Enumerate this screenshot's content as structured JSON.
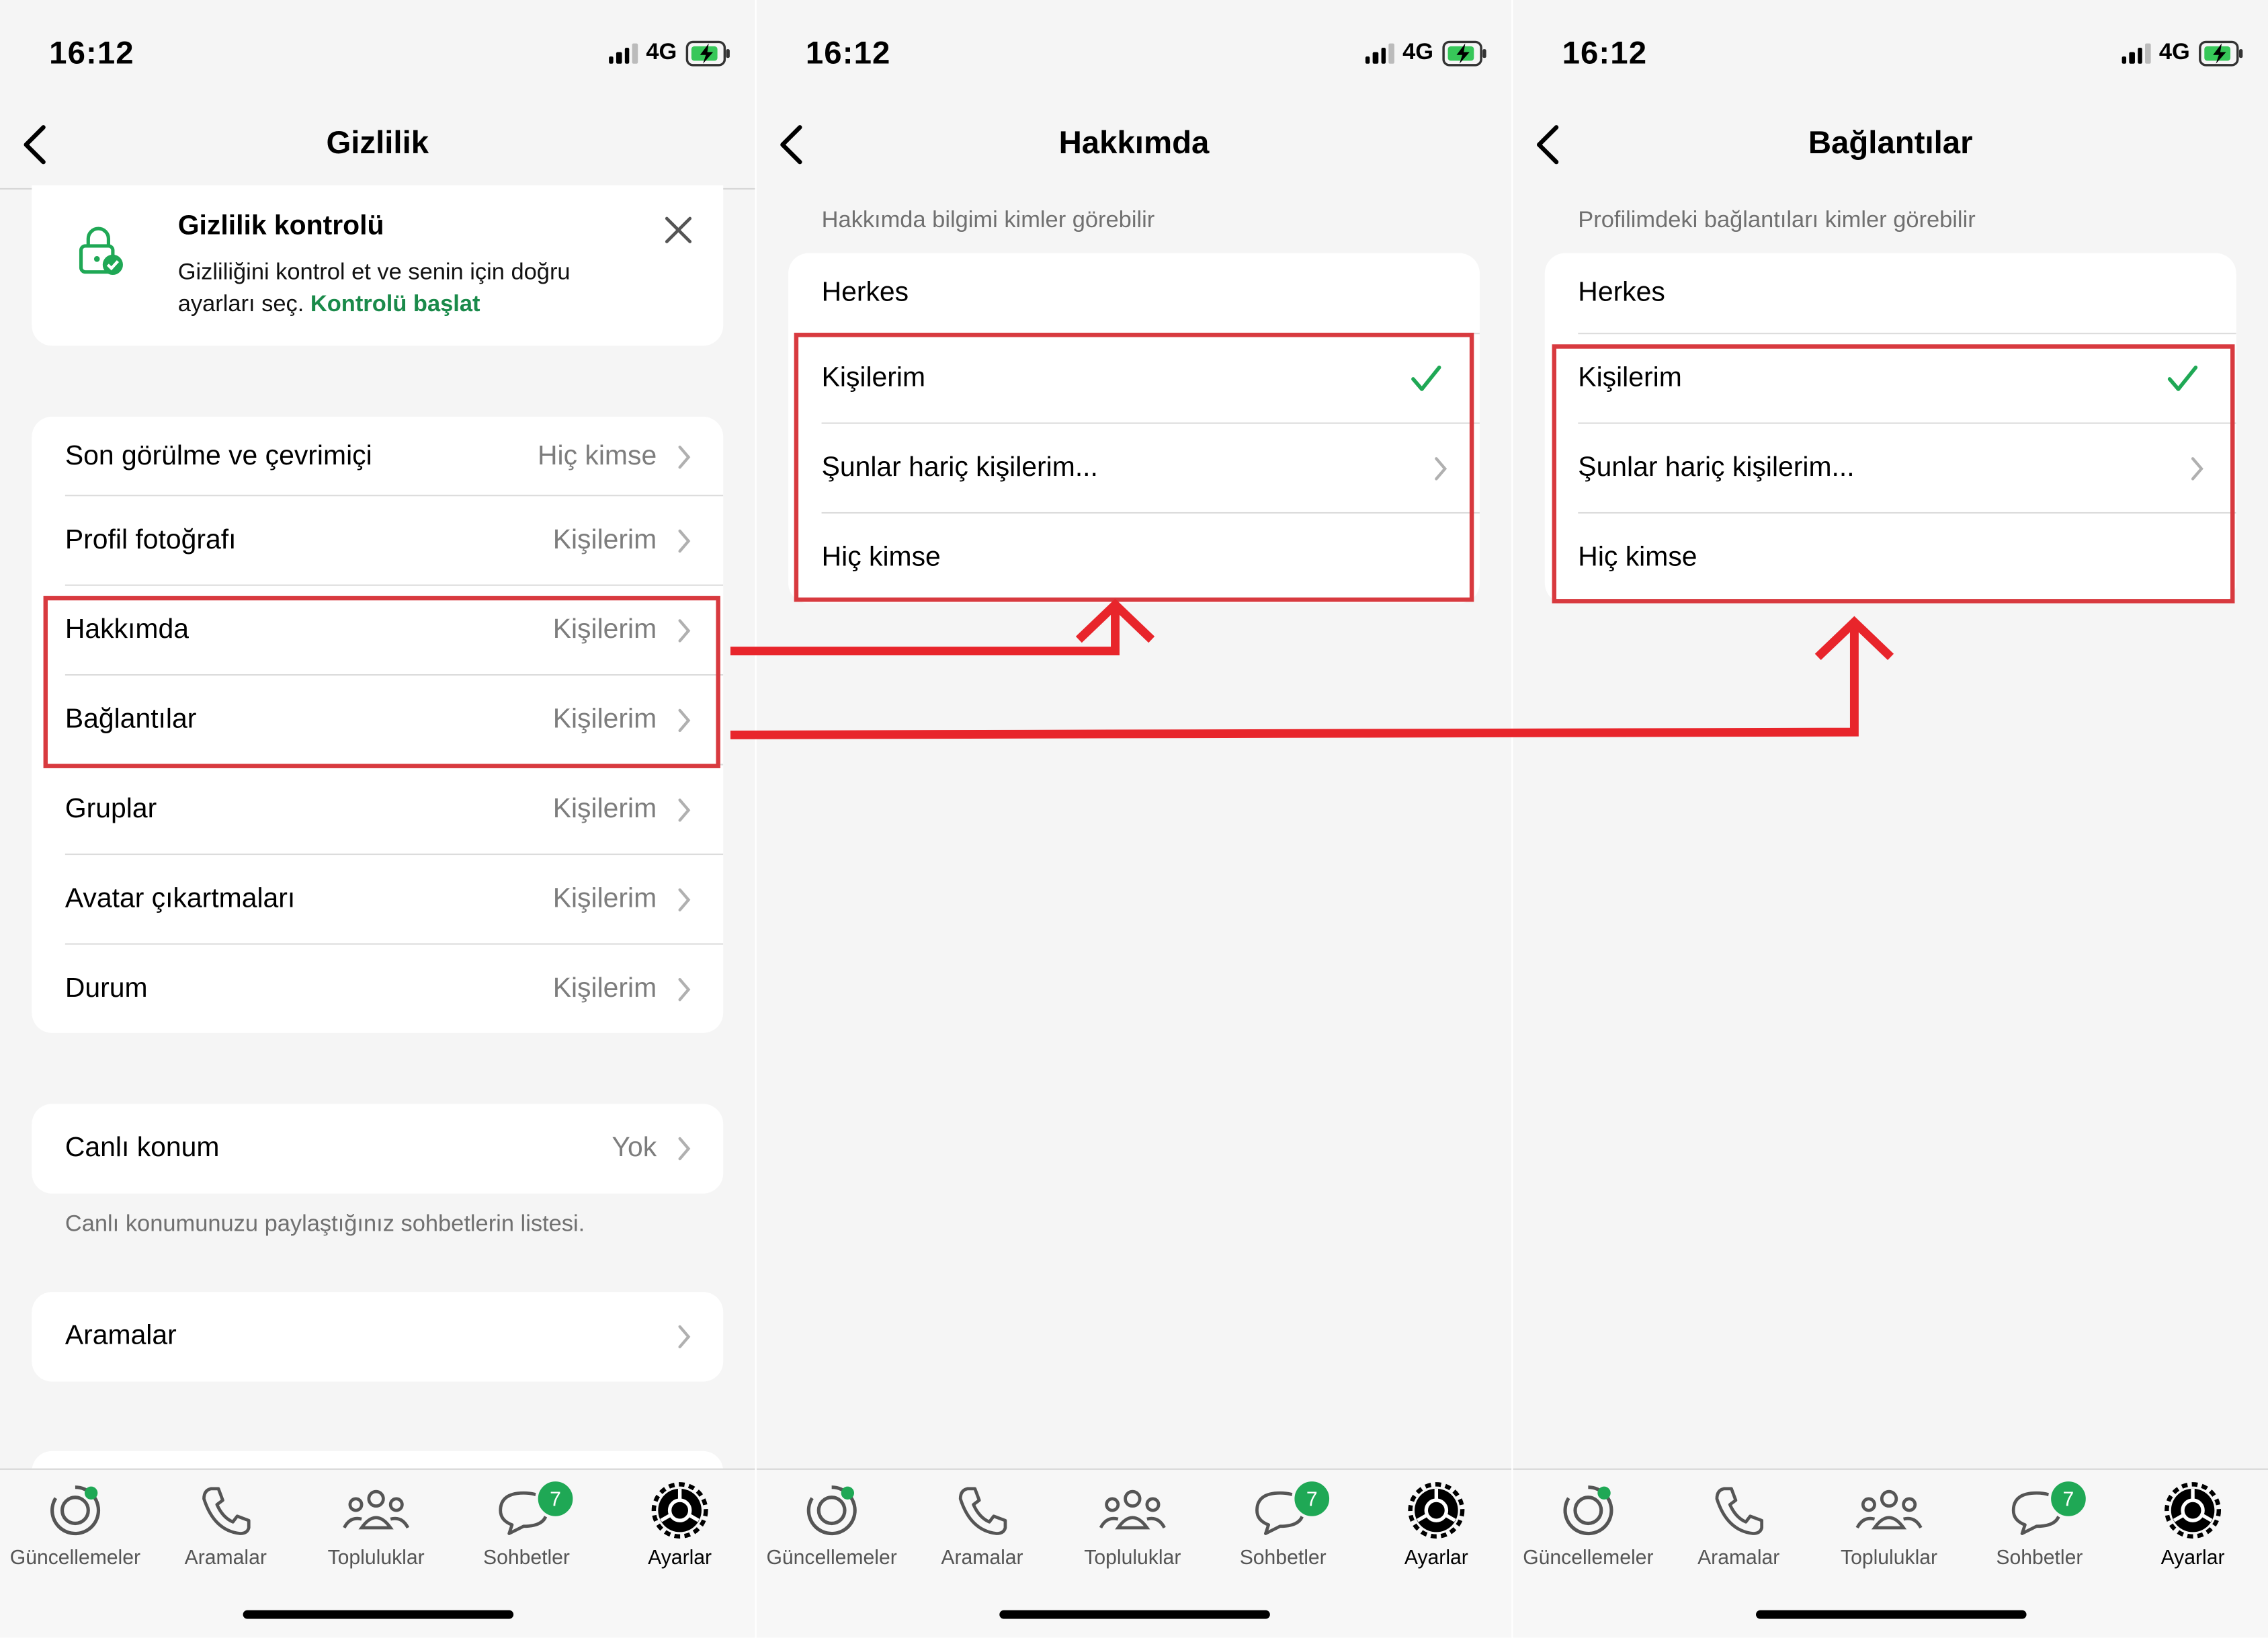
{
  "status": {
    "time": "16:12",
    "network": "4G"
  },
  "screen1": {
    "title": "Gizlilik",
    "privacy_check": {
      "title": "Gizlilik kontrolü",
      "text_line1": "Gizliliğini kontrol et ve senin için doğru",
      "text_line2": "ayarları seç.",
      "link": "Kontrolü başlat"
    },
    "items": [
      {
        "label": "Son görülme ve çevrimiçi",
        "value": "Hiç kimse"
      },
      {
        "label": "Profil fotoğrafı",
        "value": "Kişilerim"
      },
      {
        "label": "Hakkımda",
        "value": "Kişilerim"
      },
      {
        "label": "Bağlantılar",
        "value": "Kişilerim"
      },
      {
        "label": "Gruplar",
        "value": "Kişilerim"
      },
      {
        "label": "Avatar çıkartmaları",
        "value": "Kişilerim"
      },
      {
        "label": "Durum",
        "value": "Kişilerim"
      }
    ],
    "live_location": {
      "label": "Canlı konum",
      "value": "Yok",
      "note": "Canlı konumunuzu paylaştığınız sohbetlerin listesi."
    },
    "calls": {
      "label": "Aramalar"
    }
  },
  "screen2": {
    "title": "Hakkımda",
    "subtitle": "Hakkımda bilgimi kimler görebilir",
    "options": [
      "Herkes",
      "Kişilerim",
      "Şunlar hariç kişilerim...",
      "Hiç kimse"
    ],
    "selected": "Kişilerim"
  },
  "screen3": {
    "title": "Bağlantılar",
    "subtitle": "Profilimdeki bağlantıları kimler görebilir",
    "options": [
      "Herkes",
      "Kişilerim",
      "Şunlar hariç kişilerim...",
      "Hiç kimse"
    ],
    "selected": "Kişilerim"
  },
  "tabbar": {
    "items": [
      {
        "label": "Güncellemeler",
        "icon": "updates-icon"
      },
      {
        "label": "Aramalar",
        "icon": "phone-icon"
      },
      {
        "label": "Topluluklar",
        "icon": "communities-icon"
      },
      {
        "label": "Sohbetler",
        "icon": "chats-icon",
        "badge": "7"
      },
      {
        "label": "Ayarlar",
        "icon": "settings-icon",
        "active": true
      }
    ]
  },
  "colors": {
    "accent_green": "#1fa855",
    "link_green": "#1a8a4a",
    "annotation_red": "#e8252b",
    "box_red": "#d83a3f"
  }
}
